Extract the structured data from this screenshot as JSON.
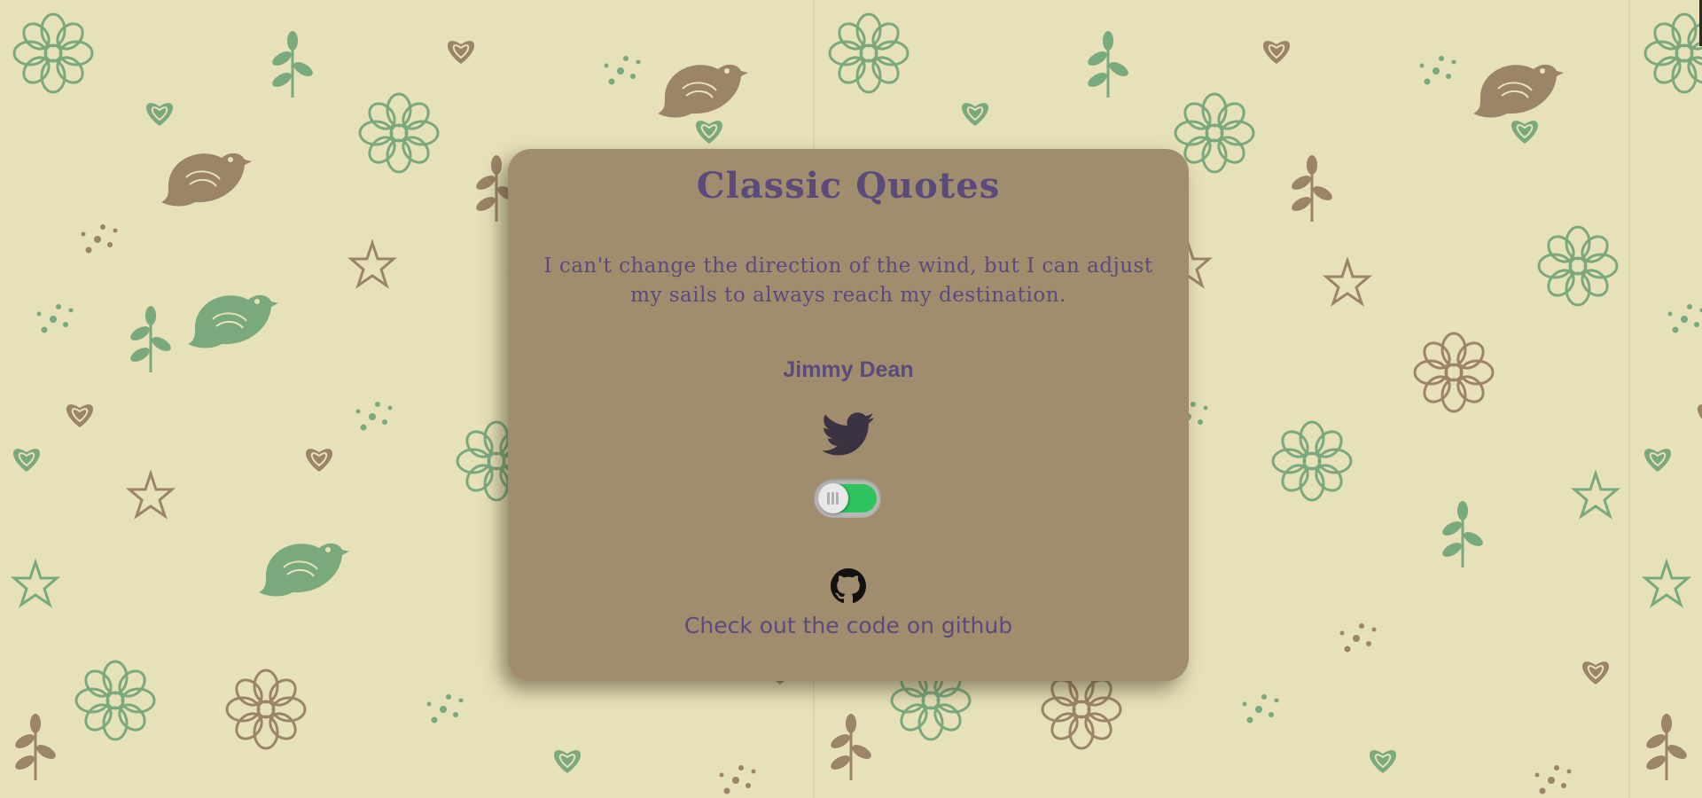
{
  "page": {
    "background_color": "#e7e1b9",
    "pattern_colors": {
      "green": "#7aa97e",
      "brown": "#9c8468"
    }
  },
  "card": {
    "background_color": "#a08d6e",
    "text_color": "#5b4a7c",
    "title": "Classic Quotes",
    "quote": "I can't change the direction of the wind, but I can adjust my sails to always reach my destination.",
    "author": "Jimmy Dean",
    "tweet_icon": "twitter-bird-icon",
    "toggle": {
      "state": "on",
      "track_color": "#2ec55f"
    },
    "github": {
      "icon": "github-icon",
      "link_text": "Check out the code on github"
    }
  }
}
